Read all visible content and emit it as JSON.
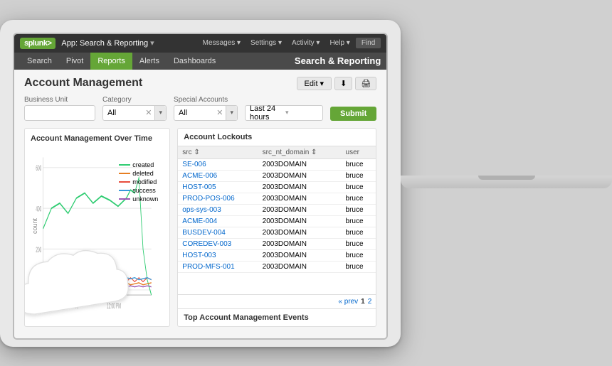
{
  "laptop": {
    "screen": "splunk-dashboard"
  },
  "topnav": {
    "logo": "splunk>",
    "app_label": "App: Search & Reporting",
    "app_arrow": "▾",
    "links": [
      "Messages ▾",
      "Settings ▾",
      "Activity ▾",
      "Help ▾"
    ],
    "find_label": "Find"
  },
  "secnav": {
    "items": [
      "Search",
      "Pivot",
      "Reports",
      "Alerts",
      "Dashboards"
    ],
    "active": "Reports",
    "app_title": "Search & Reporting"
  },
  "page": {
    "title": "Account Management",
    "edit_label": "Edit ▾",
    "export_icon": "⬇",
    "print_icon": "🖨"
  },
  "filters": {
    "business_unit_label": "Business Unit",
    "business_unit_value": "",
    "category_label": "Category",
    "category_value": "All",
    "special_accounts_label": "Special Accounts",
    "special_accounts_value": "All",
    "time_label": "",
    "time_value": "Last 24 hours",
    "time_arrow": "▾",
    "submit_label": "Submit"
  },
  "chart": {
    "title": "Account Management Over Time",
    "y_label": "count",
    "y_ticks": [
      "600",
      "400"
    ],
    "x_ticks": [
      "6:00 AM",
      "12:00 PM"
    ],
    "legend": [
      {
        "label": "created",
        "color": "#2ecc71"
      },
      {
        "label": "deleted",
        "color": "#e67e22"
      },
      {
        "label": "modified",
        "color": "#e74c3c"
      },
      {
        "label": "success",
        "color": "#3498db"
      },
      {
        "label": "unknown",
        "color": "#9b59b6"
      }
    ]
  },
  "lockouts_table": {
    "title": "Account Lockouts",
    "columns": [
      "src ⇕",
      "src_nt_domain ⇕",
      "user"
    ],
    "rows": [
      {
        "src": "SE-006",
        "domain": "2003DOMAIN",
        "user": "bruce"
      },
      {
        "src": "ACME-006",
        "domain": "2003DOMAIN",
        "user": "bruce"
      },
      {
        "src": "HOST-005",
        "domain": "2003DOMAIN",
        "user": "bruce"
      },
      {
        "src": "PROD-POS-006",
        "domain": "2003DOMAIN",
        "user": "bruce"
      },
      {
        "src": "ops-sys-003",
        "domain": "2003DOMAIN",
        "user": "bruce"
      },
      {
        "src": "ACME-004",
        "domain": "2003DOMAIN",
        "user": "bruce"
      },
      {
        "src": "BUSDEV-004",
        "domain": "2003DOMAIN",
        "user": "bruce"
      },
      {
        "src": "COREDEV-003",
        "domain": "2003DOMAIN",
        "user": "bruce"
      },
      {
        "src": "HOST-003",
        "domain": "2003DOMAIN",
        "user": "bruce"
      },
      {
        "src": "PROD-MFS-001",
        "domain": "2003DOMAIN",
        "user": "bruce"
      }
    ],
    "pagination": {
      "prev": "« prev",
      "page1": "1",
      "page2": "2"
    }
  },
  "bottom_panel": {
    "title": "Top Account Management Events"
  }
}
